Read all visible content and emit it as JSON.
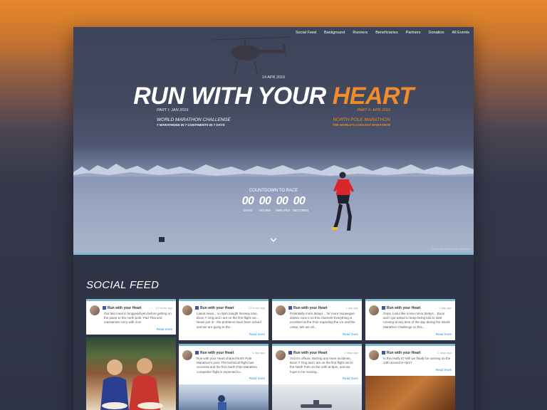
{
  "nav": [
    "Social Feed",
    "Background",
    "Runners",
    "Beneficiaries",
    "Partners",
    "Donation",
    "All Events"
  ],
  "hero": {
    "date": "14 APR 2016",
    "title_main": "RUN WITH YOUR ",
    "title_accent": "HEART",
    "part_left": "PART I: JAN 2016",
    "part_right": "PART II: APR 2016",
    "challenge_left": "WORLD MARATHON CHALLENGE",
    "challenge_left_sub": "7 MARATHONS IN 7 CONTINENTS IN 7 DAYS",
    "challenge_right": "NORTH POLE MARATHON",
    "challenge_right_sub": "THE WORLD'S COOLEST MARATHON",
    "countdown_label": "COUNTDOWN TO RACE",
    "countdown": [
      {
        "value": "00",
        "unit": "DAYS"
      },
      {
        "value": "00",
        "unit": "HOURS"
      },
      {
        "value": "00",
        "unit": "MINUTES"
      },
      {
        "value": "00",
        "unit": "SECONDS"
      }
    ],
    "copyright": "Copyright North Pole Marathon"
  },
  "social": {
    "title": "SOCIAL FEED",
    "cards": [
      {
        "name": "Run with your Heart",
        "time": "12 hours ago",
        "body": "Our last meal in longyearbyen before getting on the plane to the north pole. Pad Thai and massaman curry with rice!",
        "more": "Read more"
      },
      {
        "name": "Run with your Heart",
        "time": "13 hours ago",
        "body": "Latest news... so 8pm tonight Norway time, Boon T Ong and I are on the first flight out... News just in - the problems have been solved and we are going to the...",
        "more": "Read more"
      },
      {
        "name": "Run with your Heart",
        "time": "1 day ago",
        "body": "Potentially more delays... for more Norwegian drama, tune in to this channel! Everything is excellent at the Pole regarding the ice and the camp. We are all...",
        "more": "Read more"
      },
      {
        "name": "Run with your Heart",
        "time": "1 day ago",
        "body": "Oops, looks like some minor delays... Boon and I got asked to keep being told to start running at any time of the day during the World Marathon Challenge so this...",
        "more": "Read more"
      },
      {
        "name": "Run with your Heart",
        "time": "1 day ago",
        "body": "Run with your Heart shared North Pole Marathon's post. The technical flight has occurred and the first North Pole Marathon competitor flight is expected to...",
        "more": "Read more"
      },
      {
        "name": "Run with your Heart",
        "time": "2 days ago",
        "body": "And it's official. Barring any more incidents, Boon T Ong and I are on the first flight out to the North Pole on the 13th at 8pm, and we hope to be running...",
        "more": "Read more"
      },
      {
        "name": "Run with your Heart",
        "time": "2 days ago",
        "body": "Is this really it? Will we finally be running on the 13th around 8-7pm?",
        "more": "Read more"
      }
    ]
  }
}
